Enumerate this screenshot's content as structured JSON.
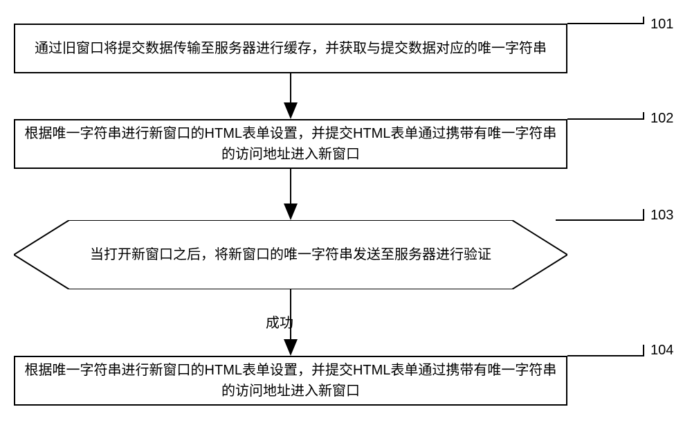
{
  "steps": {
    "s1": {
      "label": "101",
      "text": "通过旧窗口将提交数据传输至服务器进行缓存，并获取与提交数据对应的唯一字符串"
    },
    "s2": {
      "label": "102",
      "text": "根据唯一字符串进行新窗口的HTML表单设置，并提交HTML表单通过携带有唯一字符串的访问地址进入新窗口"
    },
    "s3": {
      "label": "103",
      "text": "当打开新窗口之后，将新窗口的唯一字符串发送至服务器进行验证"
    },
    "s4": {
      "label": "104",
      "text": "根据唯一字符串进行新窗口的HTML表单设置，并提交HTML表单通过携带有唯一字符串的访问地址进入新窗口"
    }
  },
  "arrow_labels": {
    "success": "成功"
  }
}
